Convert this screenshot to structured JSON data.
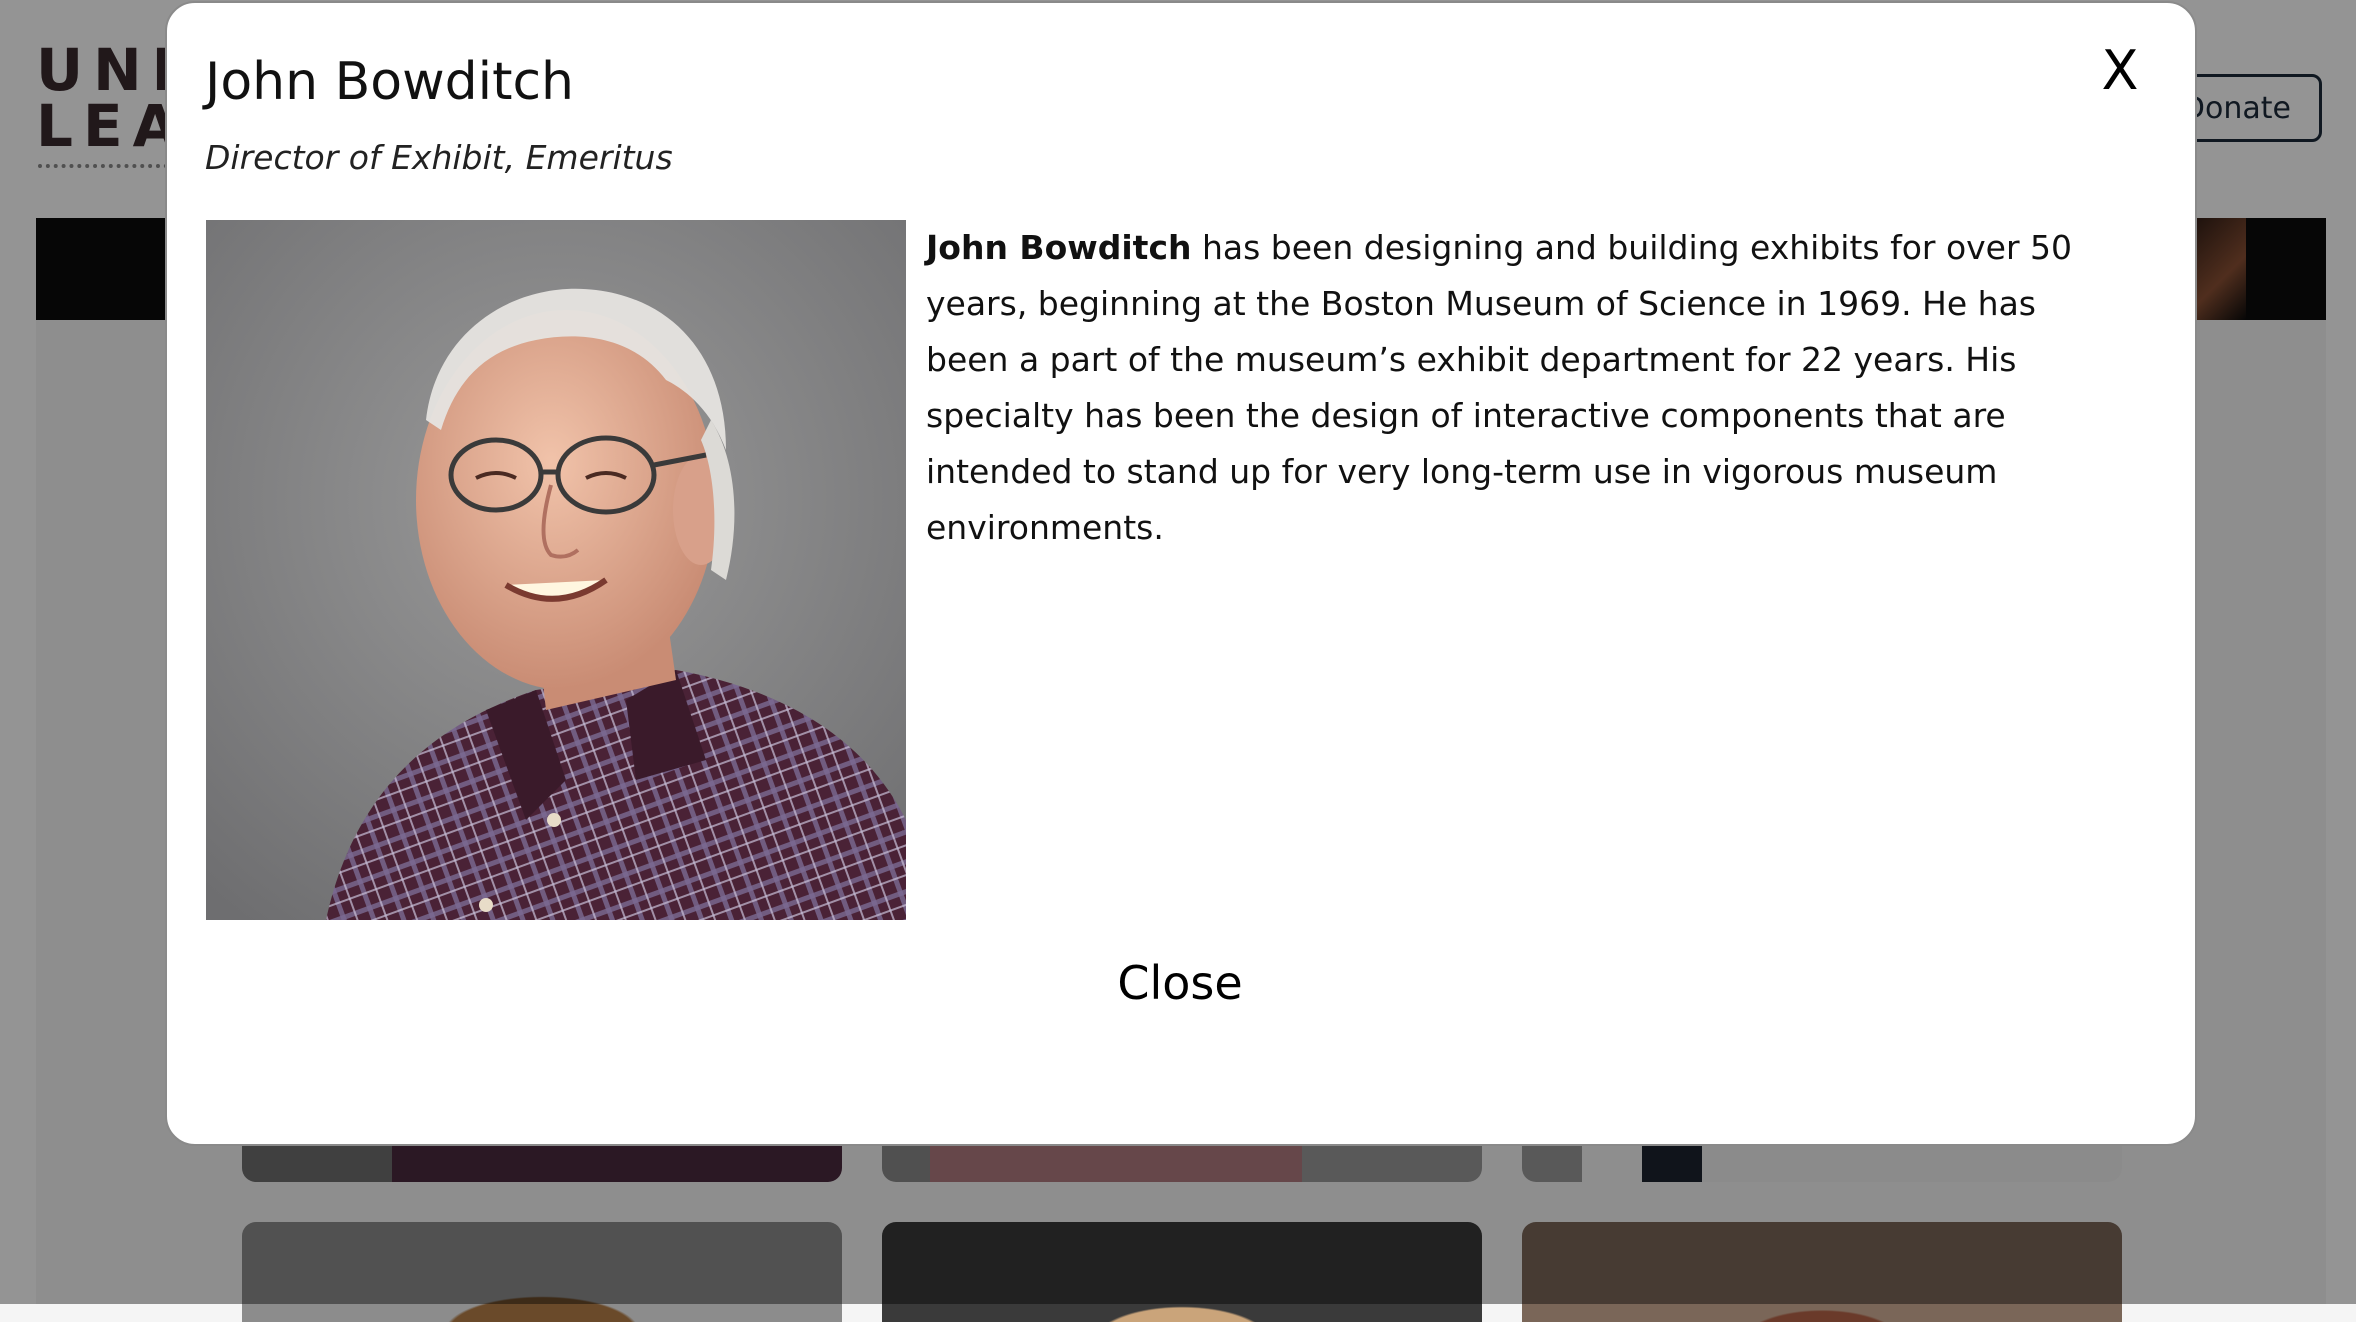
{
  "background": {
    "logo_line1": "UNI",
    "logo_line2": "LEAR",
    "donate_label": "Donate"
  },
  "modal": {
    "close_x": "X",
    "name": "John Bowditch",
    "title": "Director of Exhibit, Emeritus",
    "portrait_alt": "John Bowditch",
    "bio_name": "John Bowditch",
    "bio_text": " has been designing and building exhibits for over 50 years, beginning at the Boston Museum of Science in 1969.  He has been a part of the museum’s exhibit department for 22 years. His specialty has been the design of interactive components that are intended to stand up for very long-term use in vigorous museum environments.",
    "close_label": "Close"
  },
  "colors": {
    "overlay": "#000000",
    "modal_bg": "#ffffff",
    "logo": "#3a2a2e",
    "donate_border": "#1c2a3a"
  }
}
